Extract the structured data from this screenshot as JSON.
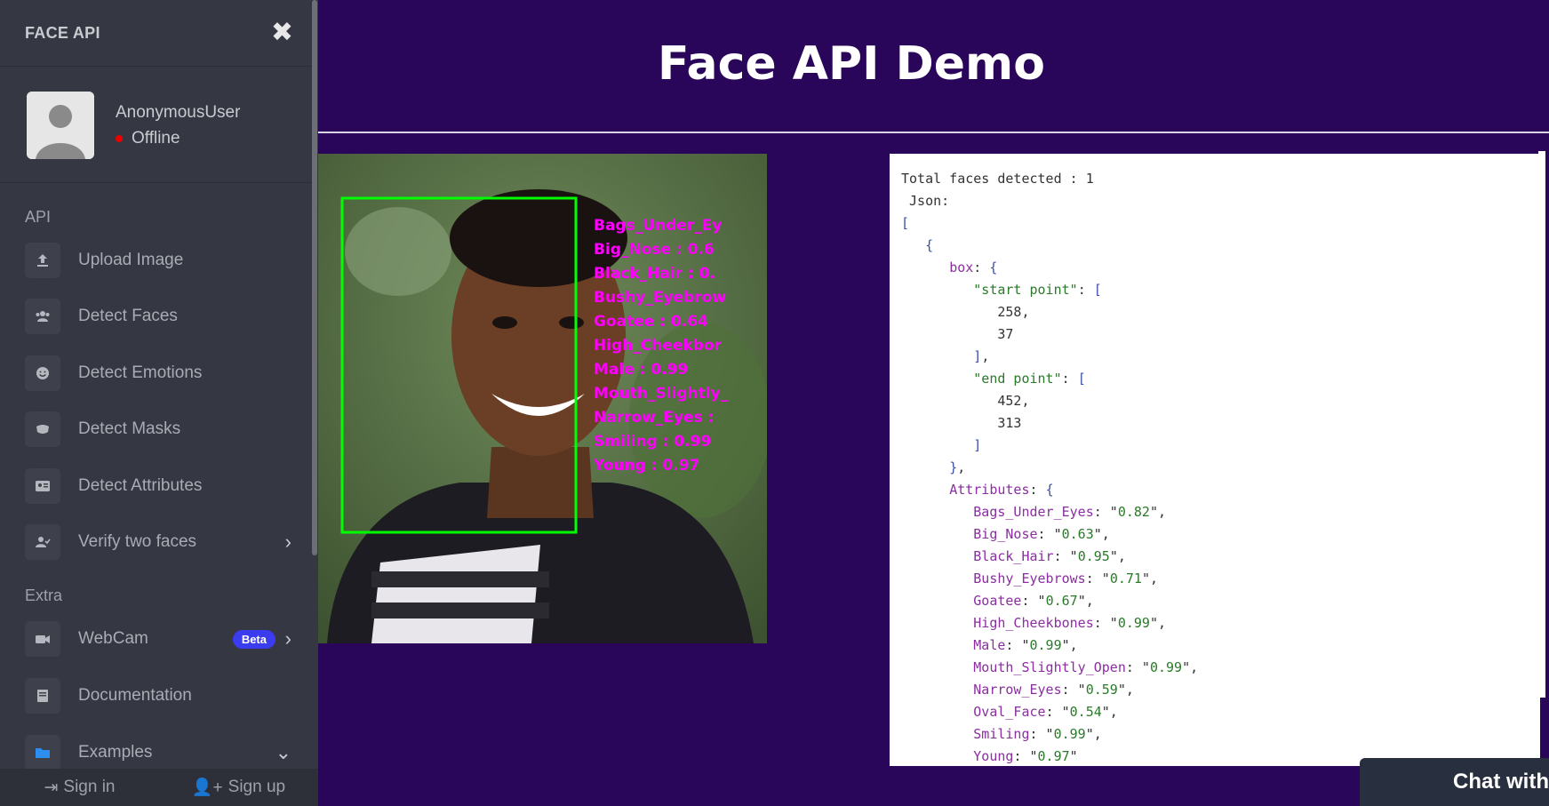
{
  "sidebar": {
    "brand": "FACE API",
    "user": {
      "name": "AnonymousUser",
      "status": "Offline"
    },
    "sections": {
      "api": "API",
      "extra": "Extra"
    },
    "api_items": [
      {
        "label": "Upload Image",
        "icon": "upload-icon"
      },
      {
        "label": "Detect Faces",
        "icon": "users-icon"
      },
      {
        "label": "Detect Emotions",
        "icon": "smile-icon"
      },
      {
        "label": "Detect Masks",
        "icon": "mask-icon"
      },
      {
        "label": "Detect Attributes",
        "icon": "id-card-icon"
      },
      {
        "label": "Verify two faces",
        "icon": "user-check-icon"
      }
    ],
    "extra_items": [
      {
        "label": "WebCam",
        "icon": "video-icon",
        "badge": "Beta"
      },
      {
        "label": "Documentation",
        "icon": "book-icon"
      },
      {
        "label": "Examples",
        "icon": "folder-icon"
      }
    ],
    "footer": {
      "signin": "Sign in",
      "signup": "Sign up"
    }
  },
  "main": {
    "title": "Face API Demo",
    "photo": {
      "box_color": "#00ff00",
      "label_color": "#ff00ff",
      "labels": [
        "Bags_Under_Ey",
        "Big_Nose : 0.6",
        "Black_Hair : 0.",
        "Bushy_Eyebrow",
        "Goatee : 0.64",
        "High_Cheekbor",
        "Male : 0.99",
        "Mouth_Slightly_",
        "Narrow_Eyes :",
        "Smiling : 0.99",
        "Young : 0.97"
      ]
    },
    "result": {
      "total_label": "Total faces detected : 1",
      "json_label": "Json:",
      "start_point": [
        "258",
        "37"
      ],
      "end_point": [
        "452",
        "313"
      ],
      "attributes": [
        {
          "key": "Bags_Under_Eyes",
          "value": "0.82"
        },
        {
          "key": "Big_Nose",
          "value": "0.63"
        },
        {
          "key": "Black_Hair",
          "value": "0.95"
        },
        {
          "key": "Bushy_Eyebrows",
          "value": "0.71"
        },
        {
          "key": "Goatee",
          "value": "0.67"
        },
        {
          "key": "High_Cheekbones",
          "value": "0.99"
        },
        {
          "key": "Male",
          "value": "0.99"
        },
        {
          "key": "Mouth_Slightly_Open",
          "value": "0.99"
        },
        {
          "key": "Narrow_Eyes",
          "value": "0.59"
        },
        {
          "key": "Oval_Face",
          "value": "0.54"
        },
        {
          "key": "Smiling",
          "value": "0.99"
        },
        {
          "key": "Young",
          "value": "0.97"
        }
      ]
    }
  },
  "chat": {
    "label": "Chat with"
  },
  "colors": {
    "background": "#2a065a",
    "sidebar": "#353742",
    "status_offline": "#ee0000",
    "badge": "#3b3bf0"
  }
}
